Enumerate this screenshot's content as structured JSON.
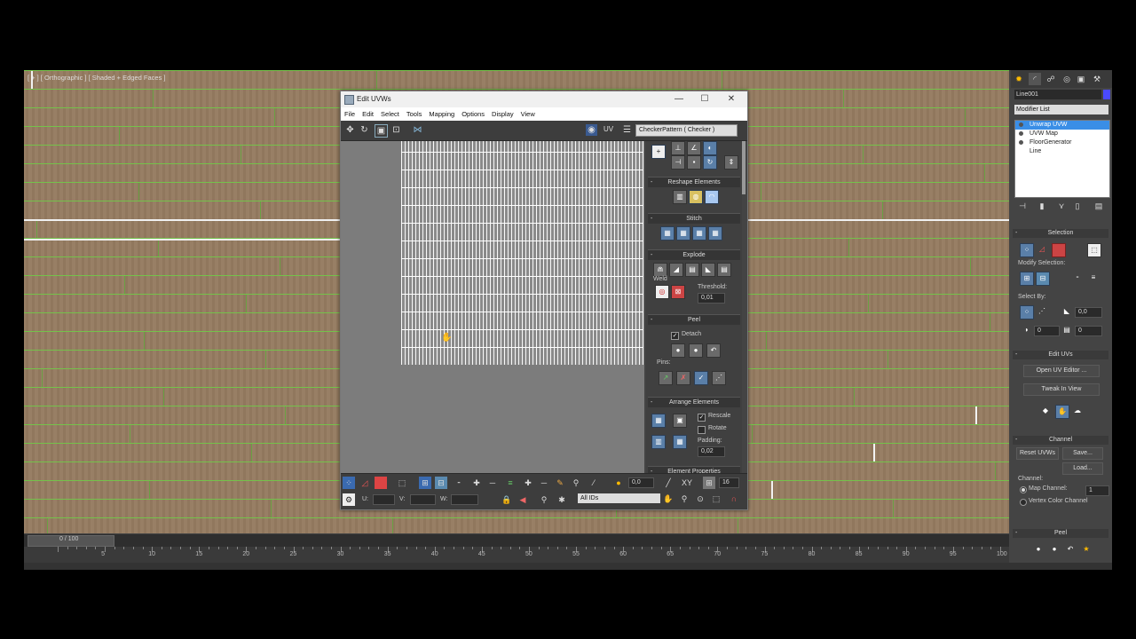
{
  "viewport": {
    "label": "[ + ] [ Orthographic ] [ Shaded + Edged Faces ]"
  },
  "uv_editor": {
    "title": "Edit UVWs",
    "window_buttons": [
      "—",
      "☐",
      "✕"
    ],
    "menu": [
      "File",
      "Edit",
      "Select",
      "Tools",
      "Mapping",
      "Options",
      "Display",
      "View"
    ],
    "uv_label": "UV",
    "texture_select": "CheckerPattern  ( Checker )",
    "rollouts": {
      "reshape": "Reshape Elements",
      "stitch": "Stitch",
      "explode": "Explode",
      "weld": "Weld",
      "threshold_label": "Threshold:",
      "threshold_value": "0,01",
      "peel": "Peel",
      "detach_label": "Detach",
      "pins_label": "Pins:",
      "arrange": "Arrange Elements",
      "rescale_label": "Rescale",
      "rotate_label": "Rotate",
      "padding_label": "Padding:",
      "padding_value": "0,02",
      "element_props": "Element Properties"
    },
    "bottom": {
      "value_a": "0,0",
      "value_b": "16",
      "xy_label": "XY",
      "u_label": "U:",
      "v_label": "V:",
      "w_label": "W:",
      "ids_select": "All IDs"
    }
  },
  "command_panel": {
    "object_name": "Line001",
    "modifier_list": "Modifier List",
    "stack": [
      "Unwrap UVW",
      "UVW Map",
      "FloorGenerator",
      "Line"
    ],
    "selection": "Selection",
    "modify_selection": "Modify Selection:",
    "select_by": "Select By:",
    "angle_value": "0,0",
    "val1": "0",
    "val2": "0",
    "edit_uvs": "Edit UVs",
    "open_uv_editor": "Open UV Editor ...",
    "tweak_in_view": "Tweak In View",
    "channel": "Channel",
    "reset_uvws": "Reset UVWs",
    "save": "Save...",
    "load": "Load...",
    "channel_label": "Channel:",
    "map_channel": "Map Channel:",
    "map_channel_value": "1",
    "vertex_color_channel": "Vertex Color Channel",
    "peel": "Peel",
    "colors": {
      "selected": "#3a8ee6",
      "swatch": "#4a4aff"
    }
  },
  "timeline": {
    "frame": "0 / 100",
    "ticks": [
      "5",
      "10",
      "15",
      "20",
      "25",
      "30",
      "35",
      "40",
      "45",
      "50",
      "55",
      "60",
      "65",
      "70",
      "75",
      "80",
      "85",
      "90",
      "95",
      "100"
    ]
  }
}
